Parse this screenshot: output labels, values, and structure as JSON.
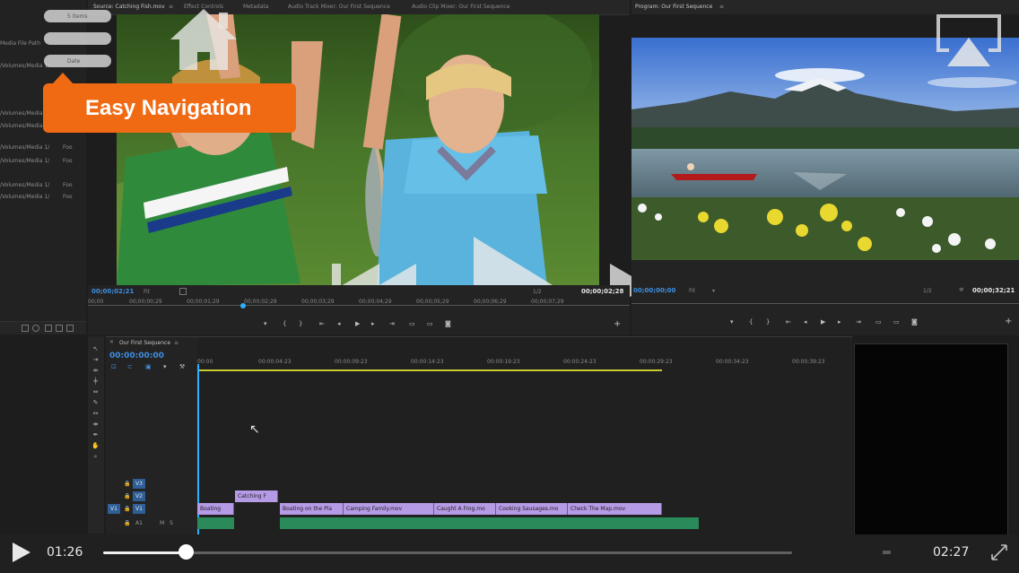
{
  "colors": {
    "accent": "#f06a14",
    "timecode_blue": "#3f8fe0",
    "video_clip": "#b59ae6",
    "audio_clip": "#2a8a5a",
    "playhead": "#2ab0ff"
  },
  "project_panel": {
    "header": "5 Items",
    "column": "Media File Path",
    "rows": [
      {
        "path": "/Volumes/Media 1/",
        "tag": ""
      },
      {
        "path": "/Volumes/Media 1/",
        "tag": ""
      },
      {
        "path": "/Volumes/Media 1/",
        "tag": ""
      },
      {
        "path": "/Volumes/Media 1/",
        "tag": "Foo"
      },
      {
        "path": "/Volumes/Media 1/",
        "tag": "Foo"
      },
      {
        "path": "/Volumes/Media 1/",
        "tag": "Foo"
      },
      {
        "path": "/Volumes/Media 1/",
        "tag": "Foo"
      }
    ]
  },
  "source_tabs": [
    "Source: Catching Fish.mov",
    "Effect Controls",
    "Metadata",
    "Audio Track Mixer: Our First Sequence",
    "Audio Clip Mixer: Our First Sequence"
  ],
  "program_tab": "Program: Our First Sequence",
  "source_monitor": {
    "timecode_in": "00;00;02;21",
    "fit": "Fit",
    "resolution": "1/2",
    "duration": "00;00;02;28",
    "ruler": [
      "00;00",
      "00;00;00;29",
      "00;00;01;29",
      "00;00;02;29",
      "00;00;03;29",
      "00;00;04;29",
      "00;00;05;29",
      "00;00;06;29",
      "00;00;07;29"
    ]
  },
  "program_monitor": {
    "timecode": "00;00;00;00",
    "fit": "Fit",
    "resolution": "1/2",
    "duration": "00;00;32;21"
  },
  "timeline": {
    "tab": "Our First Sequence",
    "timecode": "00:00:00:00",
    "ruler": [
      "00:00",
      "00:00:04:23",
      "00:00:09:23",
      "00:00:14:23",
      "00:00:19:23",
      "00:00:24:23",
      "00:00:29:23",
      "00:00:34:23",
      "00:00:39:23"
    ],
    "tracks": [
      {
        "id": "V3",
        "src": ""
      },
      {
        "id": "V2",
        "src": ""
      },
      {
        "id": "V1",
        "src": "V1"
      },
      {
        "id": "A1",
        "src": ""
      }
    ],
    "v2_clips": [
      "Catching F"
    ],
    "v1_clips": [
      "Boating",
      "Boating on the Pla",
      "Camping Family.mov",
      "Caught A Frog.mo",
      "Cooking Sausages.mo",
      "Check The Map.mov"
    ],
    "audio_labels": [
      "M",
      "S"
    ]
  },
  "overlay": {
    "menu_label": "Easy Navigation",
    "menu_item_labels": [
      "5 Items",
      "",
      "Date"
    ]
  },
  "player": {
    "current_time": "01:26",
    "end_time": "02:27",
    "progress": 0.12
  },
  "icons": [
    "menu-icon",
    "home-icon",
    "airplay-icon",
    "rewind-icon",
    "play-icon",
    "fast-forward-icon",
    "play-small-icon",
    "fullscreen-icon"
  ]
}
